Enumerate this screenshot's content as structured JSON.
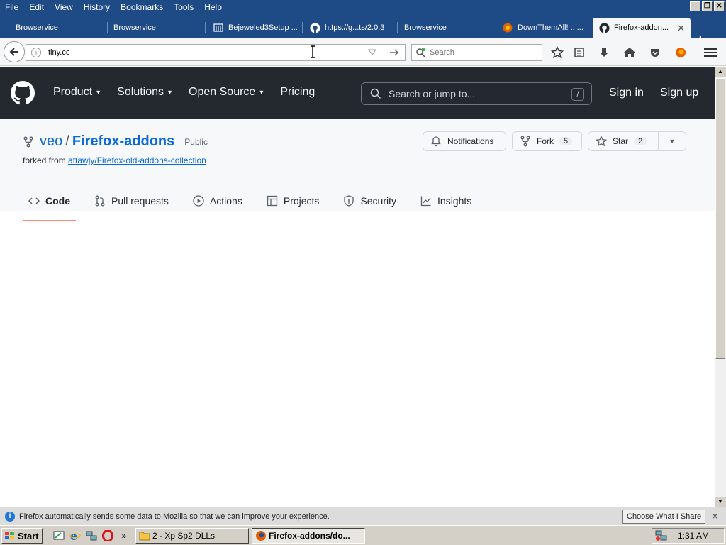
{
  "menubar": {
    "items": [
      "File",
      "Edit",
      "View",
      "History",
      "Bookmarks",
      "Tools",
      "Help"
    ]
  },
  "tabs": [
    {
      "label": "Browservice",
      "icon": "none"
    },
    {
      "label": "Browservice",
      "icon": "none"
    },
    {
      "label": "Bejeweled3Setup ...",
      "icon": "archive-icon"
    },
    {
      "label": "https://g...ts/2.0.3",
      "icon": "github-icon"
    },
    {
      "label": "Browservice",
      "icon": "none"
    },
    {
      "label": "DownThemAll! :: ...",
      "icon": "firefox-addon-icon"
    },
    {
      "label": "Firefox-addon...",
      "icon": "github-icon"
    }
  ],
  "urlbar": {
    "value": "tiny.cc"
  },
  "searchbar": {
    "placeholder": "Search"
  },
  "github": {
    "nav": [
      "Product",
      "Solutions",
      "Open Source",
      "Pricing"
    ],
    "search_placeholder": "Search or jump to...",
    "search_kbd": "/",
    "sign_in": "Sign in",
    "sign_up": "Sign up",
    "repo": {
      "owner": "veo",
      "separator": "/",
      "name": "Firefox-addons",
      "visibility": "Public",
      "forked_prefix": "forked from ",
      "forked_from": "attawjy/Firefox-old-addons-collection"
    },
    "buttons": {
      "notifications": "Notifications",
      "fork": "Fork",
      "fork_count": "5",
      "star": "Star",
      "star_count": "2"
    },
    "repo_tabs": [
      "Code",
      "Pull requests",
      "Actions",
      "Projects",
      "Security",
      "Insights"
    ]
  },
  "notification": {
    "message": "Firefox automatically sends some data to Mozilla so that we can improve your experience.",
    "button": "Choose What I Share"
  },
  "taskbar": {
    "start": "Start",
    "overflow": "»",
    "buttons": [
      "2 - Xp Sp2 DLLs",
      "Firefox-addons/do..."
    ],
    "clock": "1:31 AM"
  },
  "colors": {
    "titlebar": "#1e4b86",
    "gh_header": "#24292f",
    "gh_link": "#0969da",
    "tab_underline": "#fd8c73"
  }
}
